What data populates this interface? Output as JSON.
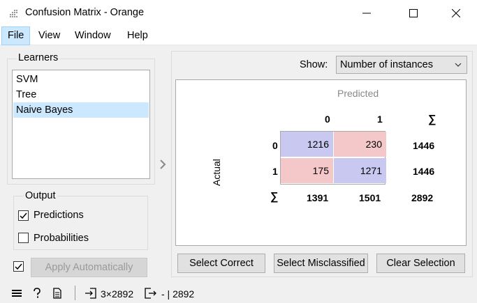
{
  "window": {
    "title": "Confusion Matrix - Orange"
  },
  "menu": {
    "items": [
      "File",
      "View",
      "Window",
      "Help"
    ]
  },
  "learners": {
    "title": "Learners",
    "items": [
      "SVM",
      "Tree",
      "Naive Bayes"
    ],
    "selected_index": 2
  },
  "output": {
    "title": "Output",
    "predictions_label": "Predictions",
    "predictions_checked": true,
    "probabilities_label": "Probabilities",
    "probabilities_checked": false
  },
  "apply": {
    "label": "Apply Automatically",
    "checked": true
  },
  "show": {
    "label": "Show:",
    "value": "Number of instances"
  },
  "matrix": {
    "predicted_label": "Predicted",
    "actual_label": "Actual",
    "col_headers": [
      "0",
      "1",
      "∑"
    ],
    "row_headers": [
      "0",
      "1",
      "∑"
    ],
    "rows": [
      [
        "1216",
        "230",
        "1446"
      ],
      [
        "175",
        "1271",
        "1446"
      ]
    ],
    "col_totals": [
      "1391",
      "1501",
      "2892"
    ],
    "correct_color": "#c8c8f0",
    "incorrect_color": "#f4c8c8"
  },
  "buttons": {
    "select_correct": "Select Correct",
    "select_misclassified": "Select Misclassified",
    "clear_selection": "Clear Selection"
  },
  "status": {
    "input": "3×2892",
    "output": "- | 2892"
  }
}
